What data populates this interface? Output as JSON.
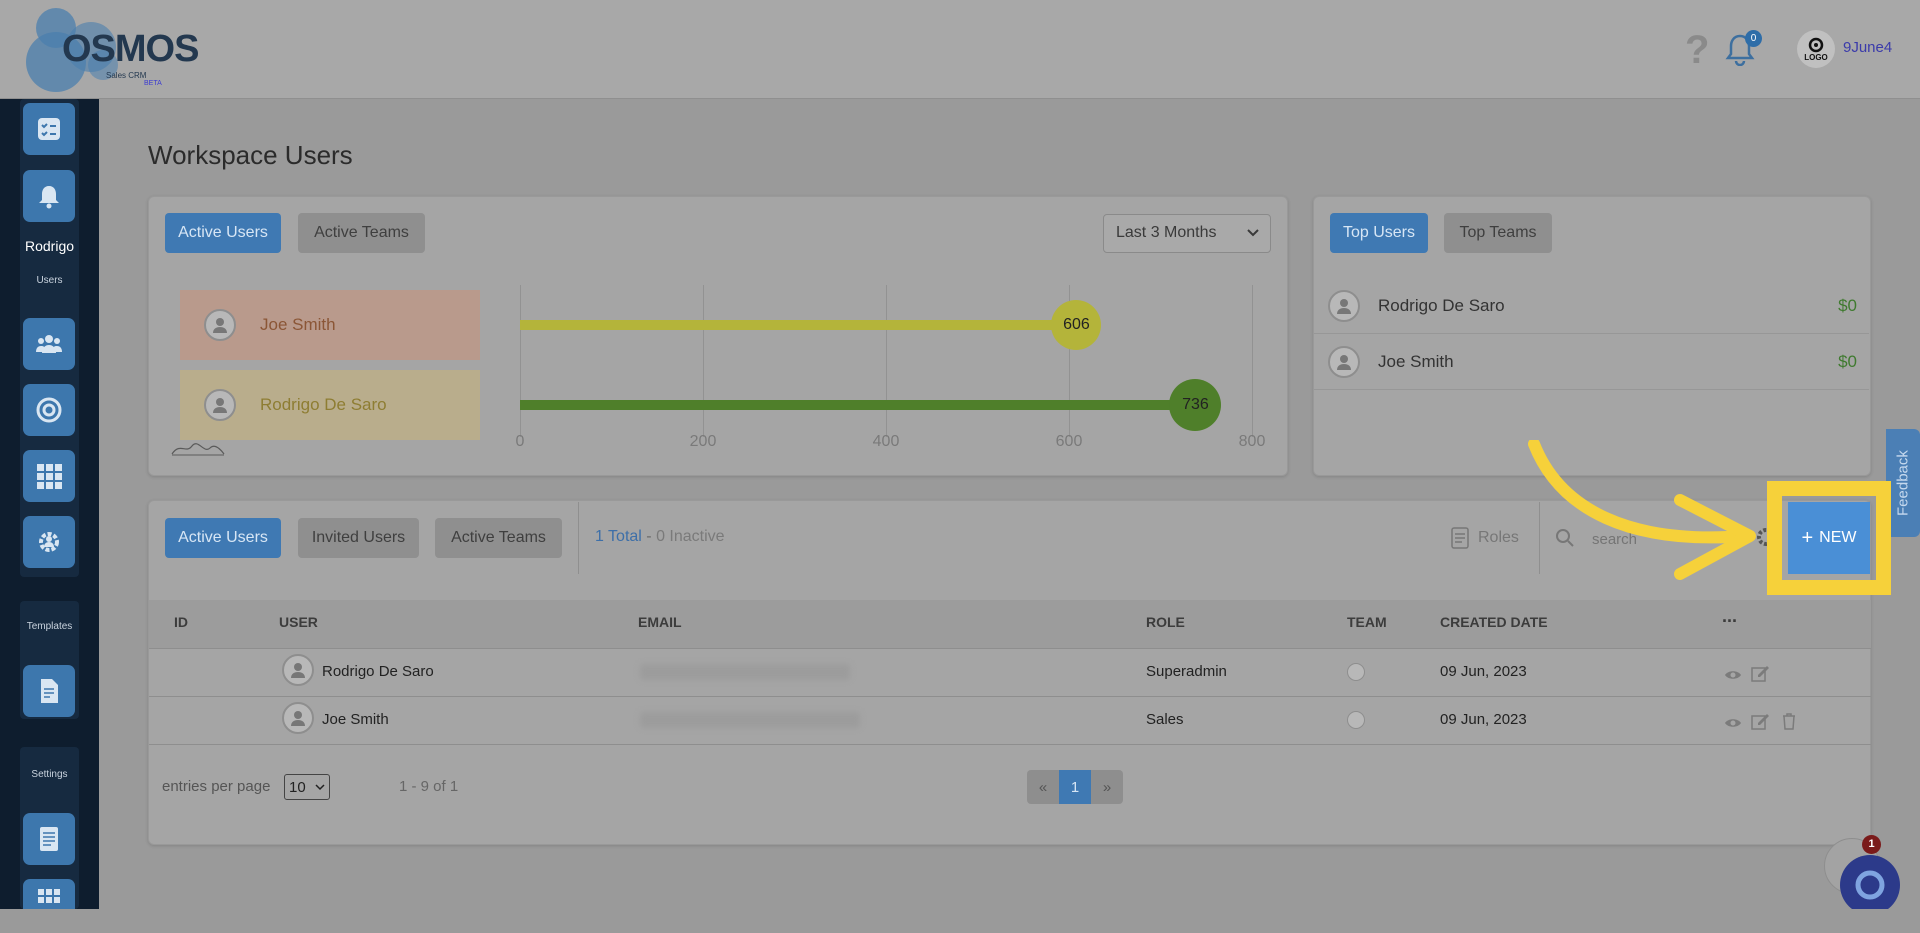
{
  "header": {
    "logo_text": "OSMOS",
    "logo_sub": "Sales CRM",
    "logo_beta": "BETA",
    "help_icon": "help-icon",
    "notifications_count": "0",
    "avatar_label": "LOGO",
    "username": "9June4"
  },
  "sidebar": {
    "user_name": "Rodrigo",
    "user_section": "Users",
    "templates_label": "Templates",
    "settings_label": "Settings"
  },
  "page_title": "Workspace Users",
  "chart_card": {
    "tabs": [
      "Active Users",
      "Active Teams"
    ],
    "period": "Last 3 Months"
  },
  "chart_data": {
    "type": "bar",
    "orientation": "horizontal",
    "categories": [
      "Joe Smith",
      "Rodrigo De Saro"
    ],
    "values": [
      606,
      736
    ],
    "xlim": [
      0,
      800
    ],
    "xticks": [
      "0",
      "200",
      "400",
      "600",
      "800"
    ],
    "colors": [
      "#b4b43a",
      "#4f7f2a"
    ]
  },
  "top_card": {
    "tabs": [
      "Top Users",
      "Top Teams"
    ],
    "users": [
      {
        "name": "Rodrigo De Saro",
        "amount": "$0"
      },
      {
        "name": "Joe Smith",
        "amount": "$0"
      }
    ]
  },
  "users_table": {
    "tabs": [
      "Active Users",
      "Invited Users",
      "Active Teams"
    ],
    "total_text": "1 Total",
    "separator": " - ",
    "inactive_text": "0 Inactive",
    "roles_label": "Roles",
    "search_placeholder": "search",
    "new_label": "NEW",
    "feedback_label": "Feedback",
    "columns": [
      "ID",
      "USER",
      "EMAIL",
      "ROLE",
      "TEAM",
      "CREATED DATE",
      "..."
    ],
    "rows": [
      {
        "user": "Rodrigo De Saro",
        "role": "Superadmin",
        "created": "09 Jun, 2023"
      },
      {
        "user": "Joe Smith",
        "role": "Sales",
        "created": "09 Jun, 2023"
      }
    ],
    "entries_label": "entries per page",
    "entries_value": "10",
    "range_text": "1 - 9 of 1",
    "pagination": {
      "prev": "«",
      "current": "1",
      "next": "»"
    }
  },
  "chat_badge": "1"
}
